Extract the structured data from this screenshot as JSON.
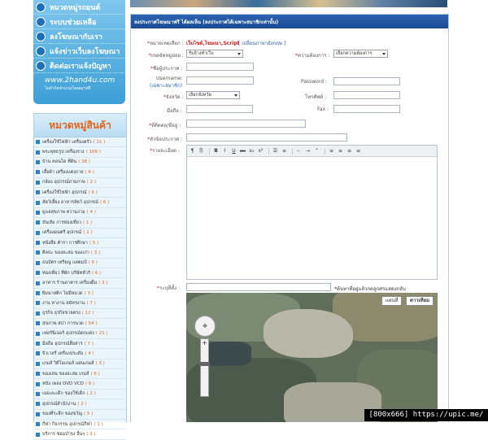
{
  "top_menu": [
    {
      "label": "หมวดหมู่รถยนต์"
    },
    {
      "label": "ระบบช่วยเหลือ"
    },
    {
      "label": "ลงโฆษณากับเรา"
    },
    {
      "label": "แจ้งข่าวเว็บลงโฆษณา"
    },
    {
      "label": "ติดต่อเราแจ้งปัญหา"
    }
  ],
  "site_logo": {
    "name": "www.2hand4u.com",
    "tagline": "ไม่จำกัดจำนวนโฆษณาฟรี"
  },
  "categories": {
    "title": "หมวดหมู่สินค้า",
    "items": [
      {
        "name": "เครื่องใช้ไฟฟ้า เครื่องครัว",
        "count": "( 21 )"
      },
      {
        "name": "พระพุทธรูป เครื่องราง",
        "count": "( 109 )"
      },
      {
        "name": "บ้าน คอนโด ที่ดิน",
        "count": "( 38 )"
      },
      {
        "name": "เสื้อผ้า เครื่องแต่งกาย",
        "count": "( 6 )"
      },
      {
        "name": "กล้อง อุปกรณ์ถ่ายภาพ",
        "count": "( 2 )"
      },
      {
        "name": "เครื่องใช้ไฟฟ้า อุปกรณ์",
        "count": "( 6 )"
      },
      {
        "name": "สัตว์เลี้ยง อาหารสัตว์ อุปกรณ์",
        "count": "( 6 )"
      },
      {
        "name": "ดูแลสุขภาพ ความงาม",
        "count": "( 4 )"
      },
      {
        "name": "บันเทิง การท่องเที่ยว",
        "count": "( 1 )"
      },
      {
        "name": "เครื่องดนตรี อุปกรณ์",
        "count": "( 1 )"
      },
      {
        "name": "หนังสือ ตำรา การศึกษา",
        "count": "( 5 )"
      },
      {
        "name": "ศิลปะ ของสะสม ของเก่า",
        "count": "( 3 )"
      },
      {
        "name": "ธนบัตร เหรียญ แสตมป์",
        "count": "( 6 )"
      },
      {
        "name": "ท่องเที่ยว ที่พัก บริษัททัวร์",
        "count": "( 6 )"
      },
      {
        "name": "อาหาร ร้านอาหาร เครื่องดื่ม",
        "count": "( 3 )"
      },
      {
        "name": "ยิมนาสติก ไม่มีหมวด",
        "count": "( 3 )"
      },
      {
        "name": "งาน หางาน สมัครงาน",
        "count": "( 7 )"
      },
      {
        "name": "ธุรกิจ ธุรกิจขายตรง",
        "count": "( 12 )"
      },
      {
        "name": "สุขภาพ สปา การนวด",
        "count": "( 54 )"
      },
      {
        "name": "เฟอร์นิเจอร์ อุปกรณ์ตกแต่ง",
        "count": "( 21 )"
      },
      {
        "name": "มือถือ อุปกรณ์สื่อสาร",
        "count": "( 7 )"
      },
      {
        "name": "จิวเวลรี่ เครื่องประดับ",
        "count": "( 4 )"
      },
      {
        "name": "เกมส์ วิดีโอเกมส์ แผ่นเกมส์",
        "count": "( 3 )"
      },
      {
        "name": "ของเล่น ของสะสม เกมส์",
        "count": "( 6 )"
      },
      {
        "name": "หนัง เพลง DVD VCD",
        "count": "( 6 )"
      },
      {
        "name": "แม่และเด็ก ของใช้เด็ก",
        "count": "( 2 )"
      },
      {
        "name": "อุปกรณ์สำนักงาน",
        "count": "( 2 )"
      },
      {
        "name": "ของที่ระลึก ของขวัญ",
        "count": "( 5 )"
      },
      {
        "name": "กีฬา กิจกรรม อุปกรณ์กีฬา",
        "count": "( 1 )"
      },
      {
        "name": "บริการ ซ่อมบำรุง อื่นๆ",
        "count": "( 3 )"
      }
    ]
  },
  "form": {
    "header": "ลงประกาศโฆษณาฟรี ได้ผลเห็น (ลงประกาศได้เฉพาะสมาชิกเท่านั้น)",
    "note_label": "หมายเหตุเลือก :",
    "note_value": "เว็บไซต์,โฆษณา,Script",
    "note_link": "[ เปลี่ยนภาษาอังกฤษ ]",
    "type_label": "เขตจัดหมู่ย่อย :",
    "type_value": "รับจ้างทำเว็บ",
    "need_label": "ความต้องการ :",
    "need_value": "เลือกความต้องการ",
    "poster_label": "ชื่อผู้ประกาศ :",
    "username_label": "Username:",
    "member_note": "(เฉพาะสมาชิก)",
    "password_label": "Password :",
    "province_label": "จังหวัด :",
    "province_value": "เลือกจังหวัด",
    "phone_label": "โทรศัพท์ :",
    "mobile_label": "มือถือ :",
    "fax_label": "Fax :",
    "address_label": "ที่ติดต่อ/ที่อยู่ :",
    "title_label": "หัวข้อประกาศ :",
    "detail_label": "รายละเอียด :",
    "map_label": "ระบุที่ตั้ง :",
    "map_hint": "*ค้นหาที่อยู่แล้วกดลูกศรแสดงกลับ",
    "map_type_map": "แผนที่",
    "map_type_sat": "ดาวเทียม"
  },
  "editor_toolbar": [
    "¶",
    "⎘",
    "B",
    "I",
    "U",
    "abc",
    "x₂",
    "x²",
    "☰",
    "≡",
    "←",
    "→",
    "“",
    "≡",
    "≡",
    "≡",
    "≡"
  ],
  "watermark": "[800x666] https://upic.me/"
}
